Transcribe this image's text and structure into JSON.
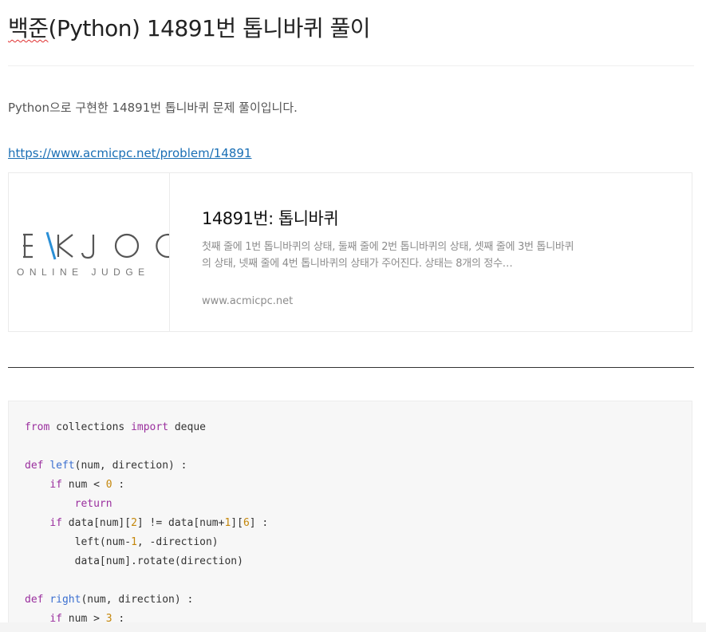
{
  "post": {
    "title_spell": "백준",
    "title_rest": "(Python) 14891번 톱니바퀴 풀이",
    "intro": "Python으로 구현한 14891번 톱니바퀴 문제 풀이입니다.",
    "link_text": "https://www.acmicpc.net/problem/14891"
  },
  "og_card": {
    "thumb_logo_top": "EKJOO",
    "thumb_logo_bottom": "ONLINE JUDGE",
    "title": "14891번: 톱니바퀴",
    "description": "첫째 줄에 1번 톱니바퀴의 상태, 둘째 줄에 2번 톱니바퀴의 상태, 셋째 줄에 3번 톱니바퀴의 상태, 넷째 줄에 4번 톱니바퀴의 상태가 주어진다. 상태는 8개의 정수…",
    "host": "www.acmicpc.net"
  },
  "code": {
    "lines": [
      [
        {
          "t": "from",
          "c": "kw"
        },
        {
          "t": " collections "
        },
        {
          "t": "import",
          "c": "kw"
        },
        {
          "t": " deque"
        }
      ],
      [],
      [
        {
          "t": "def",
          "c": "kw"
        },
        {
          "t": " "
        },
        {
          "t": "left",
          "c": "fn"
        },
        {
          "t": "(num, direction) :"
        }
      ],
      [
        {
          "t": "    "
        },
        {
          "t": "if",
          "c": "kw"
        },
        {
          "t": " num < "
        },
        {
          "t": "0",
          "c": "num"
        },
        {
          "t": " :"
        }
      ],
      [
        {
          "t": "        "
        },
        {
          "t": "return",
          "c": "kw"
        }
      ],
      [
        {
          "t": "    "
        },
        {
          "t": "if",
          "c": "kw"
        },
        {
          "t": " data[num]["
        },
        {
          "t": "2",
          "c": "num"
        },
        {
          "t": "] != data[num+"
        },
        {
          "t": "1",
          "c": "num"
        },
        {
          "t": "]["
        },
        {
          "t": "6",
          "c": "num"
        },
        {
          "t": "] :"
        }
      ],
      [
        {
          "t": "        left(num-"
        },
        {
          "t": "1",
          "c": "num"
        },
        {
          "t": ", -direction)"
        }
      ],
      [
        {
          "t": "        data[num].rotate(direction)"
        }
      ],
      [],
      [
        {
          "t": "def",
          "c": "kw"
        },
        {
          "t": " "
        },
        {
          "t": "right",
          "c": "fn"
        },
        {
          "t": "(num, direction) :"
        }
      ],
      [
        {
          "t": "    "
        },
        {
          "t": "if",
          "c": "kw"
        },
        {
          "t": " num > "
        },
        {
          "t": "3",
          "c": "num"
        },
        {
          "t": " :"
        }
      ]
    ]
  },
  "colors": {
    "link": "#1a6fb5",
    "keyword": "#9a2f9e",
    "function": "#3b6fd0",
    "number": "#c4860a",
    "logo_accent": "#2a8fd6"
  }
}
